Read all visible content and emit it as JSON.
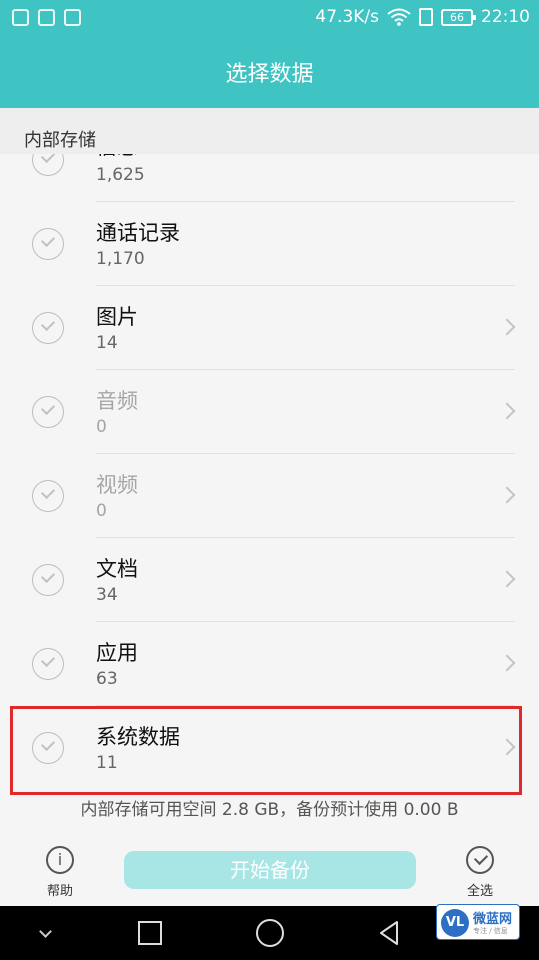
{
  "status_bar": {
    "app_icons": [
      "photo-app-icon",
      "gallery-app-icon",
      "shield-app-icon"
    ],
    "net_speed": "47.3K/s",
    "battery": "66",
    "time": "22:10"
  },
  "title": "选择数据",
  "section_header": "内部存储",
  "items": [
    {
      "label": "信息",
      "count": "1,625",
      "enabled": true,
      "has_arrow": false
    },
    {
      "label": "通话记录",
      "count": "1,170",
      "enabled": true,
      "has_arrow": false
    },
    {
      "label": "图片",
      "count": "14",
      "enabled": true,
      "has_arrow": true
    },
    {
      "label": "音频",
      "count": "0",
      "enabled": false,
      "has_arrow": true
    },
    {
      "label": "视频",
      "count": "0",
      "enabled": false,
      "has_arrow": true
    },
    {
      "label": "文档",
      "count": "34",
      "enabled": true,
      "has_arrow": true
    },
    {
      "label": "应用",
      "count": "63",
      "enabled": true,
      "has_arrow": true
    },
    {
      "label": "系统数据",
      "count": "11",
      "enabled": true,
      "has_arrow": true
    }
  ],
  "storage_note": "内部存储可用空间 2.8 GB，备份预计使用 0.00 B",
  "bottom": {
    "help_label": "帮助",
    "start_label": "开始备份",
    "select_all_label": "全选"
  },
  "watermark": {
    "logo": "VL",
    "name": "微蓝网",
    "sub": "专注 / 信息"
  },
  "colors": {
    "accent": "#3fc3c3",
    "button_disabled": "#a8e5e5",
    "highlight": "#e02a2a"
  }
}
